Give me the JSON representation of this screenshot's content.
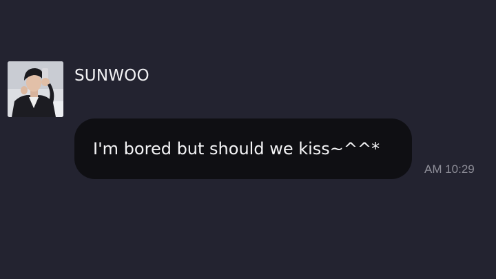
{
  "chat": {
    "sender": {
      "name": "SUNWOO",
      "avatar": "profile-photo"
    },
    "messages": [
      {
        "text": "I'm bored but should we kiss~^^*",
        "time": "AM 10:29"
      }
    ]
  },
  "colors": {
    "background": "#232330",
    "bubble": "#0f0f13",
    "text": "#f5f5f7",
    "timestamp": "#8e8e98"
  }
}
